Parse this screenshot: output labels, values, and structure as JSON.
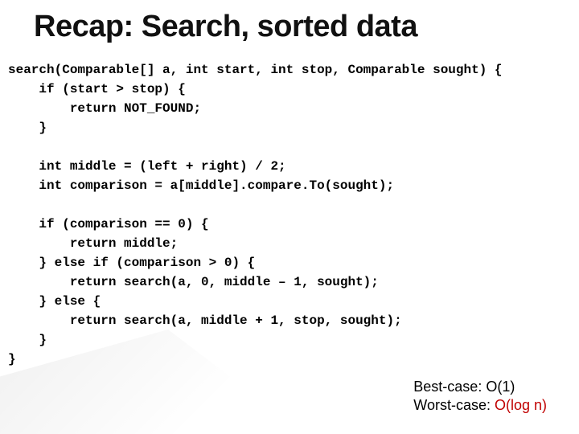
{
  "title": "Recap:  Search, sorted data",
  "code": "search(Comparable[] a, int start, int stop, Comparable sought) {\n    if (start > stop) {\n        return NOT_FOUND;\n    }\n\n    int middle = (left + right) / 2;\n    int comparison = a[middle].compare.To(sought);\n\n    if (comparison == 0) {\n        return middle;\n    } else if (comparison > 0) {\n        return search(a, 0, middle – 1, sought);\n    } else {\n        return search(a, middle + 1, stop, sought);\n    }\n}",
  "complexity": {
    "best_label": "Best-case:  ",
    "best_value": "O(1)",
    "worst_label": "Worst-case: ",
    "worst_value": "O(log  n)"
  }
}
